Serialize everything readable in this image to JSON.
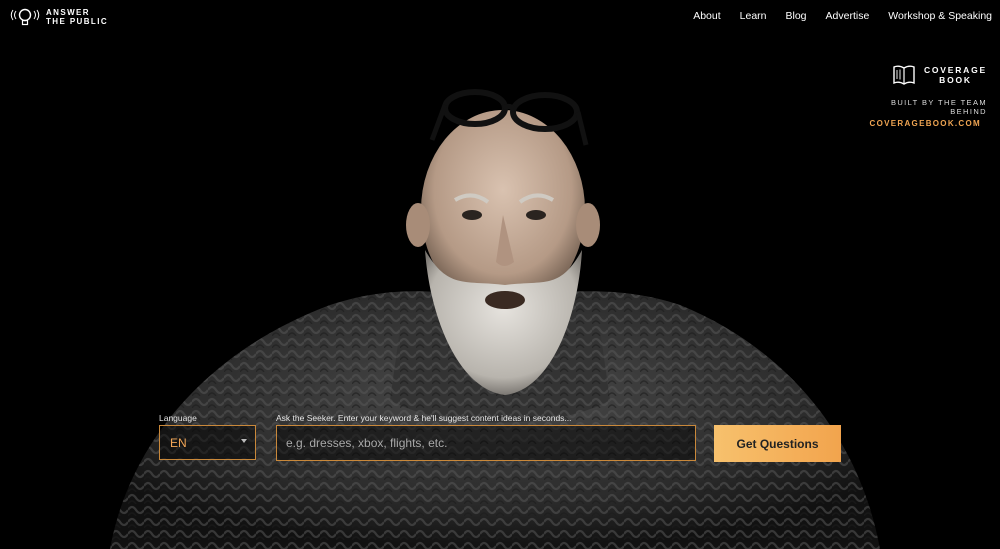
{
  "brand": {
    "logo_line1": "ANSWER",
    "logo_line2": "THE PUBLIC",
    "icon": "lightbulb-icon"
  },
  "nav": {
    "items": [
      {
        "label": "About"
      },
      {
        "label": "Learn"
      },
      {
        "label": "Blog"
      },
      {
        "label": "Advertise"
      },
      {
        "label": "Workshop & Speaking"
      }
    ]
  },
  "coverage": {
    "brand_line1": "COVERAGE",
    "brand_line2": "BOOK",
    "tagline": "BUILT BY THE TEAM BEHIND",
    "link": "COVERAGEBOOK.COM",
    "icon": "book-icon"
  },
  "search": {
    "language_label": "Language",
    "language_value": "EN",
    "keyword_label": "Ask the Seeker. Enter your keyword & he'll suggest content ideas in seconds...",
    "keyword_value": "",
    "keyword_placeholder": "e.g. dresses, xbox, flights, etc.",
    "submit_label": "Get Questions"
  },
  "colors": {
    "accent": "#f2a657",
    "button_start": "#f7c16d",
    "button_end": "#f2a44d",
    "background": "#000000"
  }
}
